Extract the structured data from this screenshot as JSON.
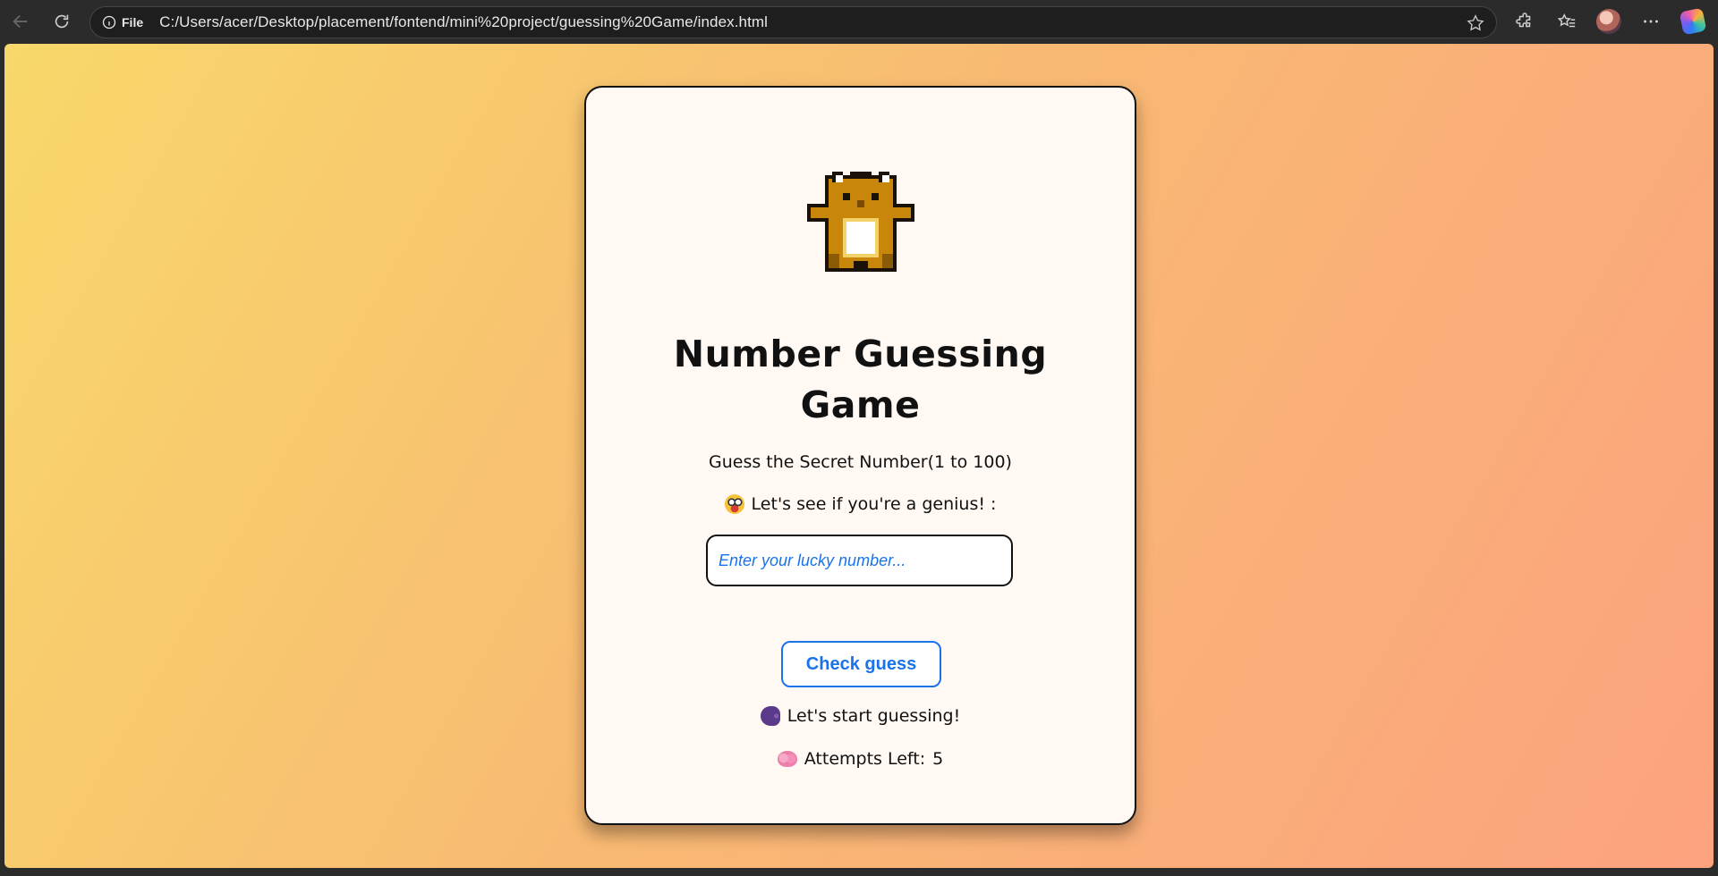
{
  "browser": {
    "site_info_label": "File",
    "url": "C:/Users/acer/Desktop/placement/fontend/mini%20project/guessing%20Game/index.html"
  },
  "game": {
    "title_line1": "Number Guessing",
    "title_line2": "Game",
    "subtitle": "Guess the Secret Number(1 to 100)",
    "prompt": "Let's see if you're a genius! :",
    "input_placeholder": "Enter your lucky number...",
    "input_value": "",
    "check_button": "Check guess",
    "message": "Let's start guessing!",
    "attempts_label": "Attempts Left:",
    "attempts_value": "5"
  },
  "colors": {
    "accent": "#1a73e8",
    "card_bg": "#fff8f3",
    "gradient_start": "#f8d86a",
    "gradient_end": "#fca27f"
  }
}
